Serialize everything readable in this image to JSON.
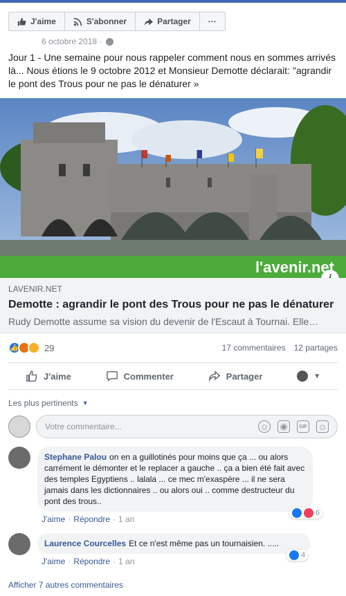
{
  "toolbar": {
    "like_label": "J'aime",
    "subscribe_label": "S'abonner",
    "share_label": "Partager",
    "more_label": "···"
  },
  "post": {
    "date": "6 octobre 2018 ·",
    "text": "Jour 1 - Une semaine pour nous rappeler comment nous en sommes arrivés là... Nous étions le 9 octobre 2012 et Monsieur Demotte déclarait: \"agrandir le pont des Trous pour ne pas le dénaturer »"
  },
  "link": {
    "image_watermark": "l'avenir.net",
    "domain": "LAVENIR.NET",
    "title": "Demotte : agrandir le pont des Trous pour ne pas le dénaturer",
    "description": "Rudy Demotte assume sa vision du devenir de l'Escaut à Tournai. Elle…",
    "info_label": "i"
  },
  "reactions": {
    "count": "29",
    "comments": "17 commentaires",
    "shares": "12 partages",
    "icons": [
      "like-icon",
      "angry-icon",
      "sad-icon"
    ]
  },
  "actions": {
    "like": "J'aime",
    "comment": "Commenter",
    "share": "Partager"
  },
  "comments_section": {
    "sort_label": "Les plus pertinents",
    "composer_placeholder": "Votre commentaire...",
    "comments": [
      {
        "author": "Stephane Palou",
        "text": "on en a guillotinés pour moins que ça ... ou alors carrément le démonter et le replacer a gauche .. ça a bien été fait avec des temples Egyptiens .. lalala ... ce mec m'exaspère ... il ne sera jamais dans les dictionnaires .. ou alors oui .. comme destructeur du pont des trous..",
        "like": "J'aime",
        "reply": "Répondre",
        "time": "1 an",
        "reaction_count": "6"
      },
      {
        "author": "Laurence Courcelles",
        "text": "Et ce n'est même pas un tournaisien. .....",
        "like": "J'aime",
        "reply": "Répondre",
        "time": "1 an",
        "reaction_count": "4"
      }
    ],
    "more_label": "Afficher 7 autres commentaires"
  },
  "colors": {
    "facebook_blue": "#4267b2",
    "link_blue": "#385898",
    "like_blue": "#1877f2",
    "banner_green": "#4cab3a"
  }
}
